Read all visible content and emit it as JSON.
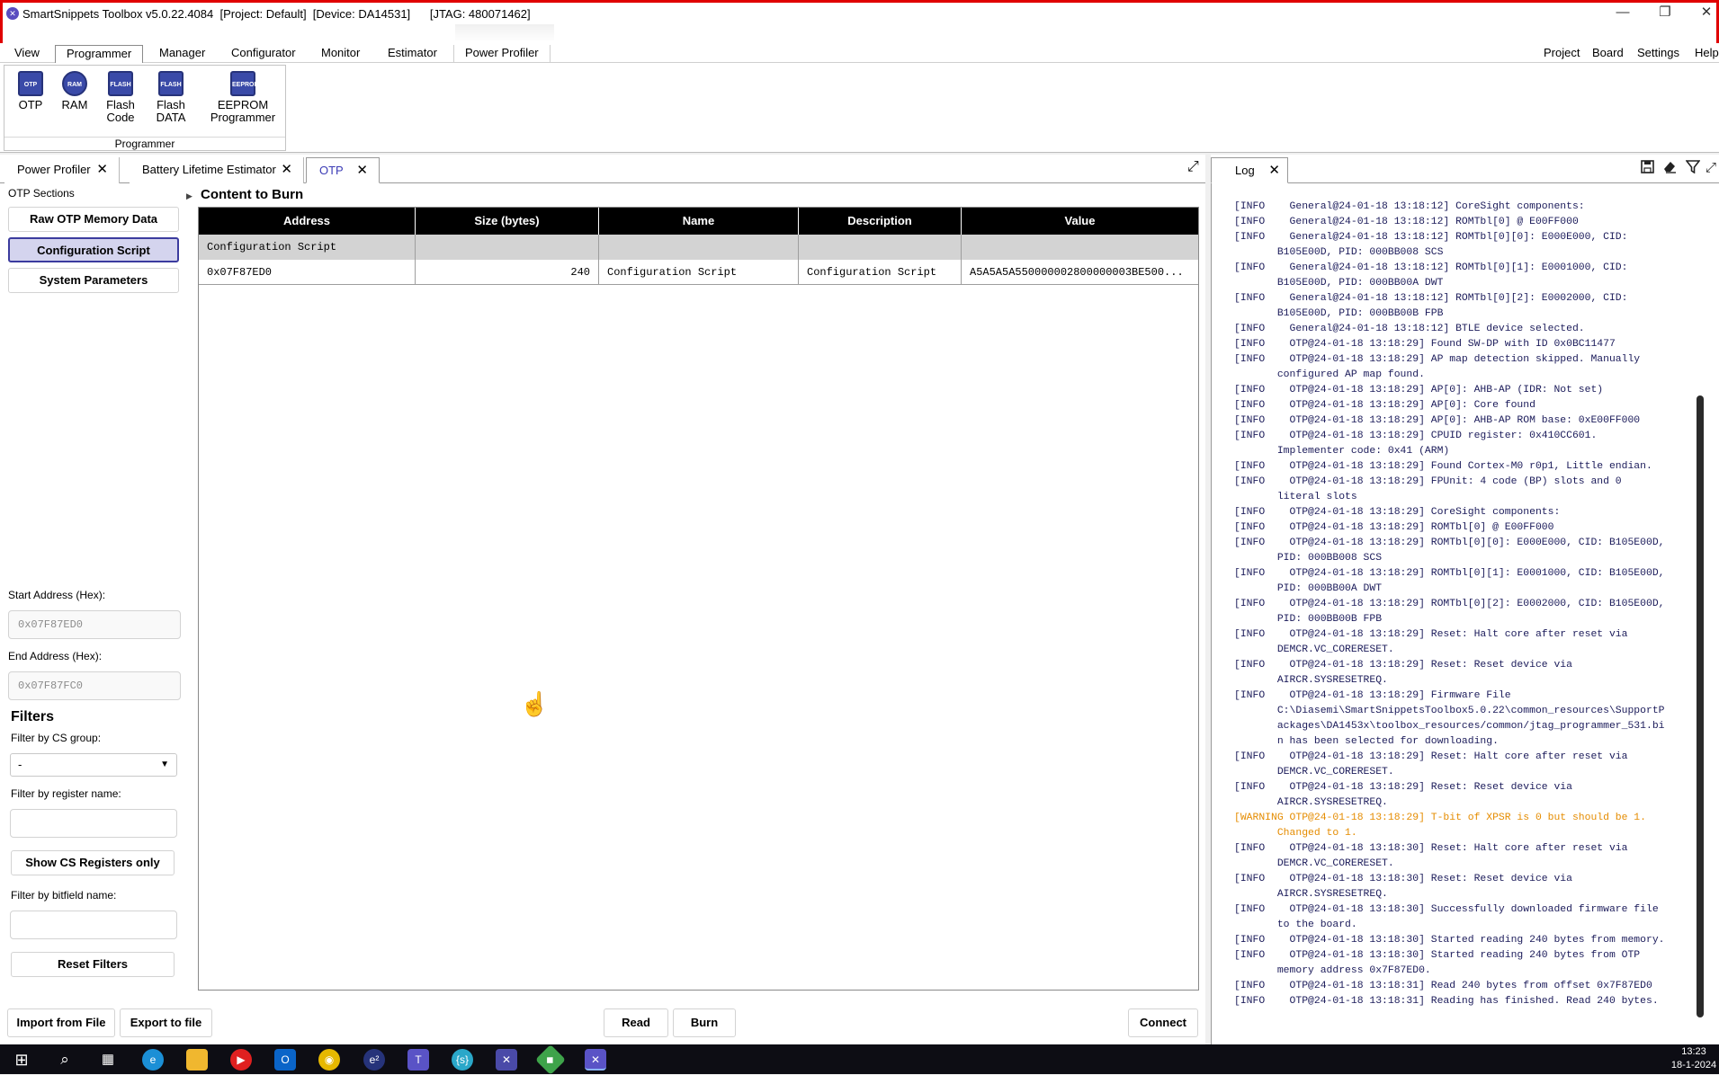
{
  "title_bar": {
    "title": "SmartSnippets Toolbox v5.0.22.4084  [Project: Default]  [Device: DA14531]      [JTAG: 480071462]",
    "minimize": "—",
    "restore": "❐",
    "close": "✕"
  },
  "menu": {
    "left": [
      "View",
      "Programmer",
      "Manager",
      "Configurator",
      "Monitor",
      "Estimator",
      "Power Profiler"
    ],
    "active": "Programmer",
    "right": [
      "Project",
      "Board",
      "Settings",
      "Help"
    ]
  },
  "ribbon": {
    "group_label": "Programmer",
    "buttons": [
      {
        "label1": "OTP",
        "label2": "",
        "chip": "OTP"
      },
      {
        "label1": "RAM",
        "label2": "",
        "chip": "RAM"
      },
      {
        "label1": "Flash",
        "label2": "Code",
        "chip": "FLASH"
      },
      {
        "label1": "Flash",
        "label2": "DATA",
        "chip": "FLASH"
      },
      {
        "label1": "EEPROM",
        "label2": "Programmer",
        "chip": "EEPROM"
      }
    ]
  },
  "tabs": [
    {
      "label": "Power Profiler",
      "close": "✕"
    },
    {
      "label": "Battery Lifetime Estimator",
      "close": "✕"
    },
    {
      "label": "OTP",
      "close": "✕"
    }
  ],
  "sidebar": {
    "sections_label": "OTP Sections",
    "buttons": [
      "Raw OTP Memory Data",
      "Configuration Script",
      "System Parameters"
    ],
    "selected": "Configuration Script",
    "start_label": "Start Address (Hex):",
    "start_value": "0x07F87ED0",
    "end_label": "End Address (Hex):",
    "end_value": "0x07F87FC0",
    "filters_title": "Filters",
    "cs_group_label": "Filter by CS group:",
    "cs_group_value": "-",
    "register_label": "Filter by register name:",
    "show_cs_button": "Show CS Registers only",
    "bitfield_label": "Filter by bitfield name:",
    "reset_button": "Reset Filters"
  },
  "content": {
    "title": "Content to Burn",
    "columns": [
      "Address",
      "Size (bytes)",
      "Name",
      "Description",
      "Value"
    ],
    "group_row": "Configuration Script",
    "row": {
      "address": "0x07F87ED0",
      "size": "240",
      "name": "Configuration Script",
      "description": "Configuration Script",
      "value": "A5A5A5A550000002800000003BE500..."
    }
  },
  "bottom_buttons": {
    "import": "Import from File",
    "export": "Export to file",
    "read": "Read",
    "burn": "Burn",
    "connect": "Connect"
  },
  "log": {
    "tab": "Log",
    "close": "✕",
    "lines": [
      "[INFO    General@24-01-18 13:18:12] CoreSight components:",
      "[INFO    General@24-01-18 13:18:12] ROMTbl[0] @ E00FF000",
      "[INFO    General@24-01-18 13:18:12] ROMTbl[0][0]: E000E000, CID:",
      "       B105E00D, PID: 000BB008 SCS",
      "[INFO    General@24-01-18 13:18:12] ROMTbl[0][1]: E0001000, CID:",
      "       B105E00D, PID: 000BB00A DWT",
      "[INFO    General@24-01-18 13:18:12] ROMTbl[0][2]: E0002000, CID:",
      "       B105E00D, PID: 000BB00B FPB",
      "[INFO    General@24-01-18 13:18:12] BTLE device selected.",
      "[INFO    OTP@24-01-18 13:18:29] Found SW-DP with ID 0x0BC11477",
      "[INFO    OTP@24-01-18 13:18:29] AP map detection skipped. Manually",
      "       configured AP map found.",
      "[INFO    OTP@24-01-18 13:18:29] AP[0]: AHB-AP (IDR: Not set)",
      "[INFO    OTP@24-01-18 13:18:29] AP[0]: Core found",
      "[INFO    OTP@24-01-18 13:18:29] AP[0]: AHB-AP ROM base: 0xE00FF000",
      "[INFO    OTP@24-01-18 13:18:29] CPUID register: 0x410CC601.",
      "       Implementer code: 0x41 (ARM)",
      "[INFO    OTP@24-01-18 13:18:29] Found Cortex-M0 r0p1, Little endian.",
      "[INFO    OTP@24-01-18 13:18:29] FPUnit: 4 code (BP) slots and 0",
      "       literal slots",
      "[INFO    OTP@24-01-18 13:18:29] CoreSight components:",
      "[INFO    OTP@24-01-18 13:18:29] ROMTbl[0] @ E00FF000",
      "[INFO    OTP@24-01-18 13:18:29] ROMTbl[0][0]: E000E000, CID: B105E00D,",
      "       PID: 000BB008 SCS",
      "[INFO    OTP@24-01-18 13:18:29] ROMTbl[0][1]: E0001000, CID: B105E00D,",
      "       PID: 000BB00A DWT",
      "[INFO    OTP@24-01-18 13:18:29] ROMTbl[0][2]: E0002000, CID: B105E00D,",
      "       PID: 000BB00B FPB",
      "[INFO    OTP@24-01-18 13:18:29] Reset: Halt core after reset via",
      "       DEMCR.VC_CORERESET.",
      "[INFO    OTP@24-01-18 13:18:29] Reset: Reset device via",
      "       AIRCR.SYSRESETREQ.",
      "[INFO    OTP@24-01-18 13:18:29] Firmware File",
      "       C:\\Diasemi\\SmartSnippetsToolbox5.0.22\\common_resources\\SupportP",
      "       ackages\\DA1453x\\toolbox_resources/common/jtag_programmer_531.bi",
      "       n has been selected for downloading.",
      "[INFO    OTP@24-01-18 13:18:29] Reset: Halt core after reset via",
      "       DEMCR.VC_CORERESET.",
      "[INFO    OTP@24-01-18 13:18:29] Reset: Reset device via",
      "       AIRCR.SYSRESETREQ.",
      "[WARNING OTP@24-01-18 13:18:29] T-bit of XPSR is 0 but should be 1.",
      "       Changed to 1.",
      "[INFO    OTP@24-01-18 13:18:30] Reset: Halt core after reset via",
      "       DEMCR.VC_CORERESET.",
      "[INFO    OTP@24-01-18 13:18:30] Reset: Reset device via",
      "       AIRCR.SYSRESETREQ.",
      "[INFO    OTP@24-01-18 13:18:30] Successfully downloaded firmware file",
      "       to the board.",
      "[INFO    OTP@24-01-18 13:18:30] Started reading 240 bytes from memory.",
      "[INFO    OTP@24-01-18 13:18:30] Started reading 240 bytes from OTP",
      "       memory address 0x7F87ED0.",
      "[INFO    OTP@24-01-18 13:18:31] Read 240 bytes from offset 0x7F87ED0",
      "[INFO    OTP@24-01-18 13:18:31] Reading has finished. Read 240 bytes."
    ],
    "warning_color": "#e58c00"
  },
  "taskbar": {
    "time": "13:23",
    "date": "18-1-2024"
  }
}
